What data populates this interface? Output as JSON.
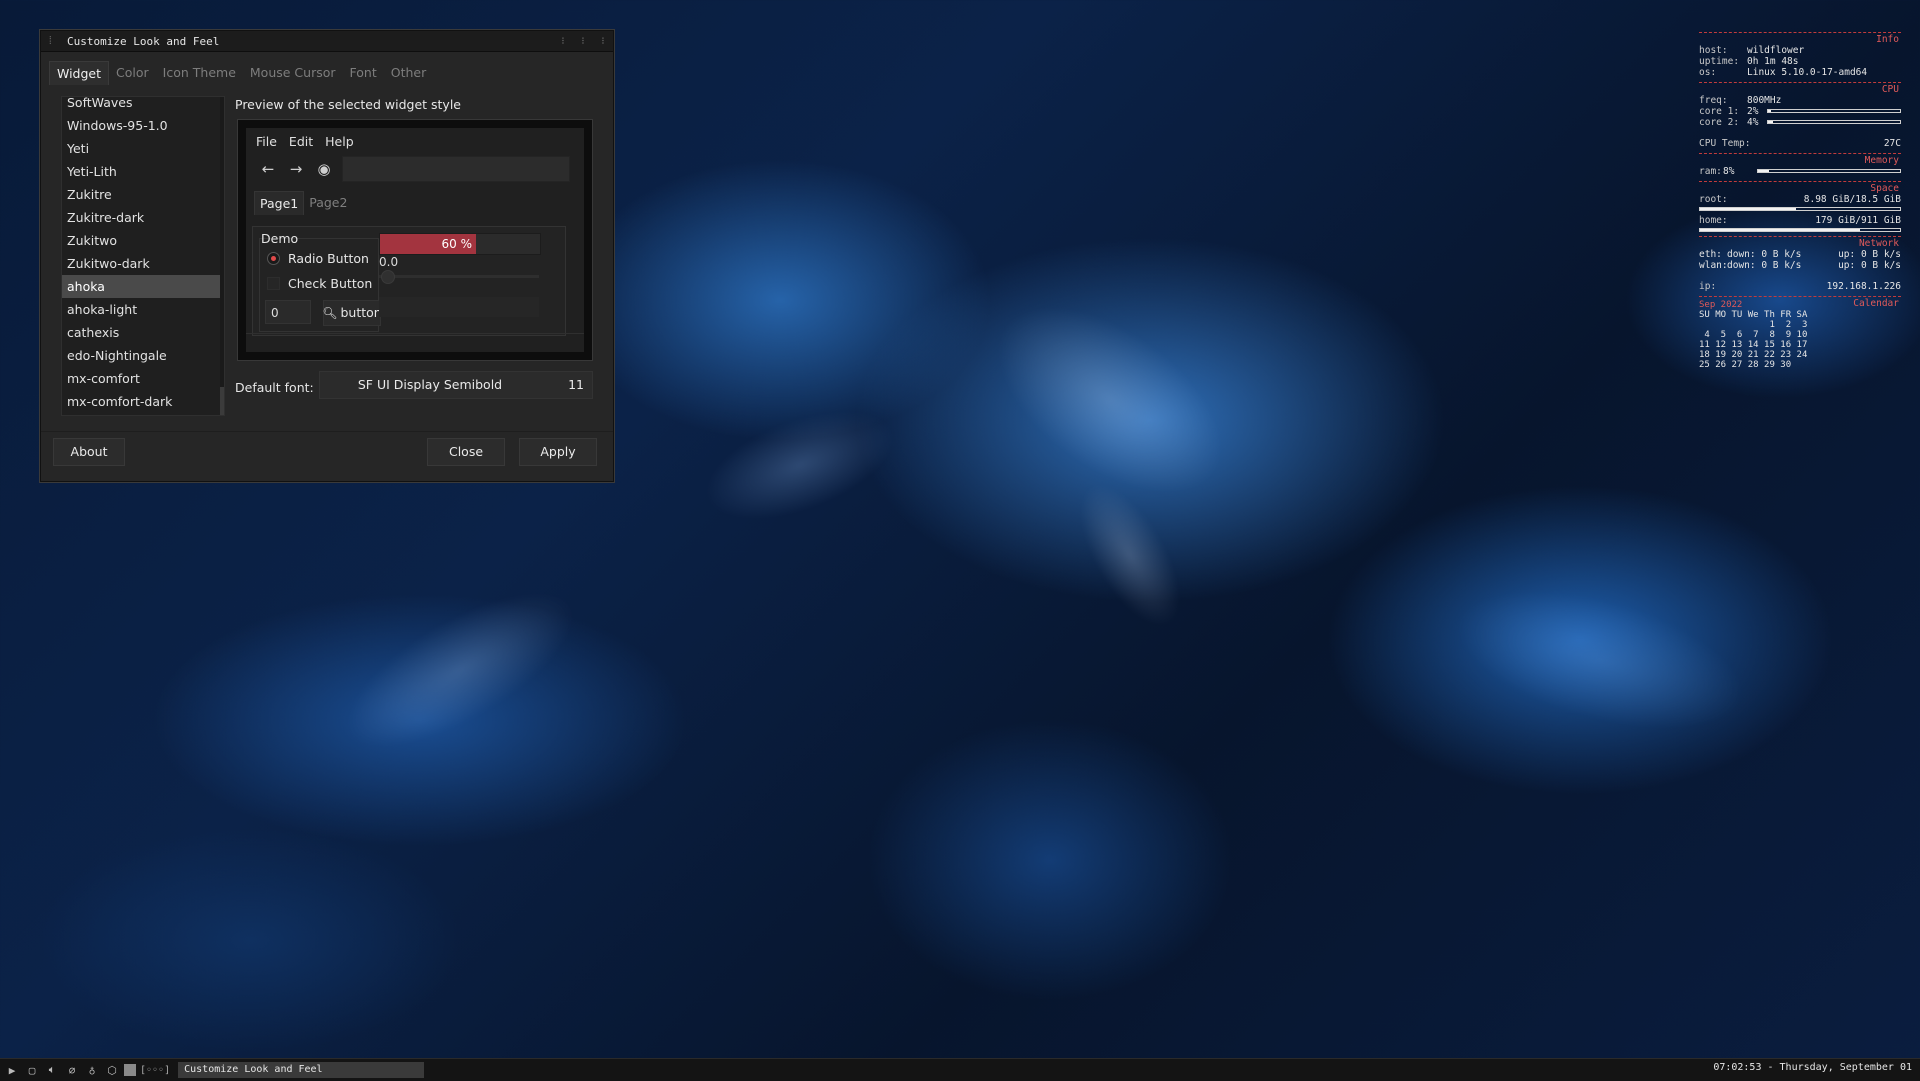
{
  "window": {
    "title": "Customize Look and Feel",
    "tabs": [
      "Widget",
      "Color",
      "Icon Theme",
      "Mouse Cursor",
      "Font",
      "Other"
    ],
    "themes": [
      "SoftWaves",
      "Windows-95-1.0",
      "Yeti",
      "Yeti-Lith",
      "Zukitre",
      "Zukitre-dark",
      "Zukitwo",
      "Zukitwo-dark",
      "ahoka",
      "ahoka-light",
      "cathexis",
      "edo-Nightingale",
      "mx-comfort",
      "mx-comfort-dark"
    ],
    "selected_theme": "ahoka",
    "preview_label": "Preview of the selected widget style",
    "preview": {
      "menu": [
        "File",
        "Edit",
        "Help"
      ],
      "pages": [
        "Page1",
        "Page2"
      ],
      "group": "Demo",
      "radio_label": "Radio Button",
      "check_label": "Check Button",
      "spin_value": "0",
      "button_label": "button",
      "progress_text": "60 %",
      "progress_value": 60,
      "scale_value": "0.0"
    },
    "default_font_label": "Default font:",
    "font_name": "SF UI Display Semibold",
    "font_size": "11",
    "about": "About",
    "close": "Close",
    "apply": "Apply",
    "accent_color": "#a3343f"
  },
  "conky": {
    "info_head": "Info",
    "host_k": "host:",
    "host_v": "wildflower",
    "uptime_k": "uptime:",
    "uptime_v": "0h 1m 48s",
    "os_k": "os:",
    "os_v": "Linux 5.10.0-17-amd64",
    "cpu_head": "CPU",
    "freq_k": "freq:",
    "freq_v": "800MHz",
    "core1_k": "core 1:",
    "core1_v": "2%",
    "core1_pct": 2,
    "core2_k": "core 2:",
    "core2_v": "4%",
    "core2_pct": 4,
    "temp_k": "CPU Temp:",
    "temp_v": "27C",
    "mem_head": "Memory",
    "ram_k": "ram:",
    "ram_v": "8%",
    "ram_pct": 8,
    "space_head": "Space",
    "root_k": "root:",
    "root_v": "8.98 GiB/18.5 GiB",
    "root_pct": 48,
    "home_k": "home:",
    "home_v": "179 GiB/911 GiB",
    "home_pct": 80,
    "net_head": "Network",
    "eth_k": "eth:",
    "eth_down": "down: 0 B k/s",
    "eth_up": "up: 0 B k/s",
    "wlan_k": "wlan:",
    "wlan_down": "down: 0 B k/s",
    "wlan_up": "up: 0 B k/s",
    "ip_k": "ip:",
    "ip_v": "192.168.1.226",
    "cal_head": "Calendar",
    "month": "Sep 2022",
    "cal_days": "SU MO TU We Th FR SA",
    "cal_w1": "             1  2  3",
    "cal_w2": " 4  5  6  7  8  9 10",
    "cal_w3": "11 12 13 14 15 16 17",
    "cal_w4": "18 19 20 21 22 23 24",
    "cal_w5": "25 26 27 28 29 30"
  },
  "taskbar": {
    "workspace": "[◦◦◦]",
    "task": "Customize Look and Feel",
    "clock": "07:02:53 - Thursday, September 01"
  }
}
